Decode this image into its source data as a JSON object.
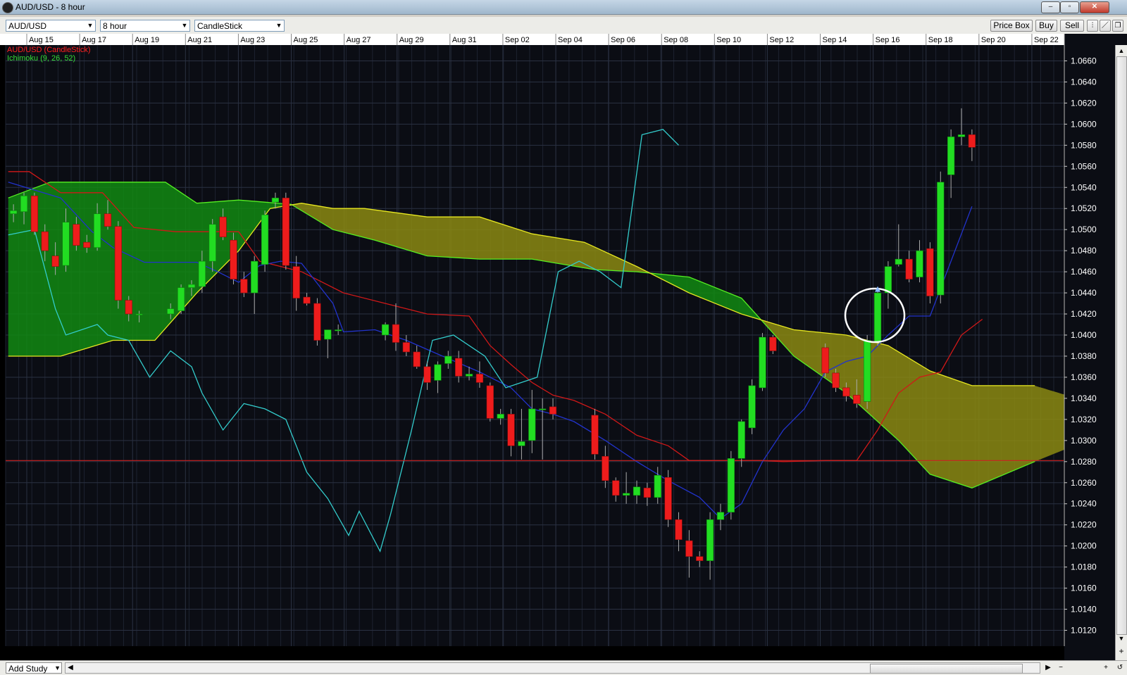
{
  "window": {
    "title": "AUD/USD - 8 hour",
    "controls": {
      "minimize": "–",
      "maximize": "▫",
      "close": "✕"
    }
  },
  "toolbar": {
    "instrument": "AUD/USD",
    "timeframe": "8 hour",
    "chart_type": "CandleStick",
    "price_box": "Price Box",
    "buy": "Buy",
    "sell": "Sell",
    "tool_icons": [
      "bar-icon",
      "draw-icon",
      "popout-icon"
    ]
  },
  "legend": {
    "series1": "AUD/USD (CandleStick)",
    "series1_color": "#ff2020",
    "series2": "Ichimoku (9, 26, 52)",
    "series2_color": "#33dd33"
  },
  "bottom": {
    "add_study": "Add Study"
  },
  "chart_data": {
    "type": "candlestick",
    "instrument": "AUD/USD",
    "timeframe": "8 hour",
    "x_labels": [
      "Aug 15",
      "Aug 17",
      "Aug 19",
      "Aug 21",
      "Aug 23",
      "Aug 25",
      "Aug 27",
      "Aug 29",
      "Aug 31",
      "Sep 02",
      "Sep 04",
      "Sep 06",
      "Sep 08",
      "Sep 10",
      "Sep 12",
      "Sep 14",
      "Sep 16",
      "Sep 18",
      "Sep 20",
      "Sep 22"
    ],
    "y_ticks": [
      "1.0660",
      "1.0640",
      "1.0620",
      "1.0600",
      "1.0580",
      "1.0560",
      "1.0540",
      "1.0520",
      "1.0500",
      "1.0480",
      "1.0460",
      "1.0440",
      "1.0420",
      "1.0400",
      "1.0380",
      "1.0360",
      "1.0340",
      "1.0320",
      "1.0300",
      "1.0280",
      "1.0260",
      "1.0240",
      "1.0220",
      "1.0200",
      "1.0180",
      "1.0160",
      "1.0140",
      "1.0120"
    ],
    "ylim": [
      1.0105,
      1.0675
    ],
    "x_range_bars": [
      0,
      202
    ],
    "horizontal_line": 1.0281,
    "candles": [
      {
        "i": 1,
        "o": 1.0515,
        "h": 1.0524,
        "l": 1.0507,
        "c": 1.0518
      },
      {
        "i": 3,
        "o": 1.0517,
        "h": 1.0535,
        "l": 1.0505,
        "c": 1.0532
      },
      {
        "i": 5,
        "o": 1.0532,
        "h": 1.0535,
        "l": 1.0495,
        "c": 1.0498
      },
      {
        "i": 7,
        "o": 1.0498,
        "h": 1.0505,
        "l": 1.047,
        "c": 1.048
      },
      {
        "i": 9,
        "o": 1.0475,
        "h": 1.0488,
        "l": 1.0457,
        "c": 1.0465
      },
      {
        "i": 11,
        "o": 1.0466,
        "h": 1.052,
        "l": 1.046,
        "c": 1.0507
      },
      {
        "i": 13,
        "o": 1.0505,
        "h": 1.0512,
        "l": 1.048,
        "c": 1.0485
      },
      {
        "i": 15,
        "o": 1.0488,
        "h": 1.0495,
        "l": 1.0478,
        "c": 1.0483
      },
      {
        "i": 17,
        "o": 1.0483,
        "h": 1.0525,
        "l": 1.048,
        "c": 1.0515
      },
      {
        "i": 19,
        "o": 1.0515,
        "h": 1.0528,
        "l": 1.05,
        "c": 1.0503
      },
      {
        "i": 21,
        "o": 1.0503,
        "h": 1.0508,
        "l": 1.0425,
        "c": 1.0433
      },
      {
        "i": 23,
        "o": 1.0433,
        "h": 1.0437,
        "l": 1.0413,
        "c": 1.042
      },
      {
        "i": 25,
        "o": 1.042,
        "h": 1.0423,
        "l": 1.0412,
        "c": 1.042
      },
      {
        "i": 31,
        "o": 1.042,
        "h": 1.043,
        "l": 1.0415,
        "c": 1.0425
      },
      {
        "i": 33,
        "o": 1.0423,
        "h": 1.0448,
        "l": 1.042,
        "c": 1.0445
      },
      {
        "i": 35,
        "o": 1.0445,
        "h": 1.0452,
        "l": 1.0437,
        "c": 1.0448
      },
      {
        "i": 37,
        "o": 1.0446,
        "h": 1.048,
        "l": 1.044,
        "c": 1.047
      },
      {
        "i": 39,
        "o": 1.047,
        "h": 1.051,
        "l": 1.046,
        "c": 1.0505
      },
      {
        "i": 41,
        "o": 1.0512,
        "h": 1.052,
        "l": 1.049,
        "c": 1.0493
      },
      {
        "i": 43,
        "o": 1.049,
        "h": 1.0497,
        "l": 1.0448,
        "c": 1.0453
      },
      {
        "i": 45,
        "o": 1.0453,
        "h": 1.046,
        "l": 1.0436,
        "c": 1.044
      },
      {
        "i": 47,
        "o": 1.044,
        "h": 1.0475,
        "l": 1.042,
        "c": 1.047
      },
      {
        "i": 49,
        "o": 1.0467,
        "h": 1.0518,
        "l": 1.046,
        "c": 1.0514
      },
      {
        "i": 51,
        "o": 1.0526,
        "h": 1.0535,
        "l": 1.052,
        "c": 1.053
      },
      {
        "i": 53,
        "o": 1.053,
        "h": 1.0535,
        "l": 1.0462,
        "c": 1.0466
      },
      {
        "i": 55,
        "o": 1.0465,
        "h": 1.0475,
        "l": 1.0423,
        "c": 1.0435
      },
      {
        "i": 57,
        "o": 1.0436,
        "h": 1.044,
        "l": 1.0428,
        "c": 1.043
      },
      {
        "i": 59,
        "o": 1.043,
        "h": 1.0435,
        "l": 1.039,
        "c": 1.0395
      },
      {
        "i": 61,
        "o": 1.0396,
        "h": 1.0405,
        "l": 1.0378,
        "c": 1.0405
      },
      {
        "i": 63,
        "o": 1.0405,
        "h": 1.041,
        "l": 1.04,
        "c": 1.0405
      },
      {
        "i": 72,
        "o": 1.04,
        "h": 1.0412,
        "l": 1.0395,
        "c": 1.041
      },
      {
        "i": 74,
        "o": 1.041,
        "h": 1.043,
        "l": 1.0385,
        "c": 1.0393
      },
      {
        "i": 76,
        "o": 1.0393,
        "h": 1.04,
        "l": 1.038,
        "c": 1.0384
      },
      {
        "i": 78,
        "o": 1.0384,
        "h": 1.039,
        "l": 1.0368,
        "c": 1.037
      },
      {
        "i": 80,
        "o": 1.037,
        "h": 1.0375,
        "l": 1.0348,
        "c": 1.0355
      },
      {
        "i": 82,
        "o": 1.0357,
        "h": 1.0375,
        "l": 1.0345,
        "c": 1.0372
      },
      {
        "i": 84,
        "o": 1.0373,
        "h": 1.0385,
        "l": 1.0368,
        "c": 1.038
      },
      {
        "i": 86,
        "o": 1.0378,
        "h": 1.0385,
        "l": 1.0355,
        "c": 1.0361
      },
      {
        "i": 88,
        "o": 1.0361,
        "h": 1.037,
        "l": 1.0357,
        "c": 1.0363
      },
      {
        "i": 90,
        "o": 1.0363,
        "h": 1.0375,
        "l": 1.035,
        "c": 1.0355
      },
      {
        "i": 92,
        "o": 1.0352,
        "h": 1.0355,
        "l": 1.0318,
        "c": 1.0321
      },
      {
        "i": 94,
        "o": 1.0321,
        "h": 1.033,
        "l": 1.0315,
        "c": 1.0325
      },
      {
        "i": 96,
        "o": 1.0325,
        "h": 1.033,
        "l": 1.0285,
        "c": 1.0295
      },
      {
        "i": 98,
        "o": 1.0295,
        "h": 1.033,
        "l": 1.0282,
        "c": 1.0299
      },
      {
        "i": 100,
        "o": 1.03,
        "h": 1.0348,
        "l": 1.0288,
        "c": 1.033
      },
      {
        "i": 102,
        "o": 1.033,
        "h": 1.034,
        "l": 1.0282,
        "c": 1.033
      },
      {
        "i": 104,
        "o": 1.0332,
        "h": 1.034,
        "l": 1.032,
        "c": 1.0325
      },
      {
        "i": 112,
        "o": 1.0324,
        "h": 1.033,
        "l": 1.0282,
        "c": 1.0287
      },
      {
        "i": 114,
        "o": 1.0285,
        "h": 1.0295,
        "l": 1.0255,
        "c": 1.0262
      },
      {
        "i": 116,
        "o": 1.0262,
        "h": 1.0265,
        "l": 1.0242,
        "c": 1.0248
      },
      {
        "i": 118,
        "o": 1.0248,
        "h": 1.027,
        "l": 1.024,
        "c": 1.025
      },
      {
        "i": 120,
        "o": 1.0248,
        "h": 1.0262,
        "l": 1.024,
        "c": 1.0256
      },
      {
        "i": 122,
        "o": 1.0255,
        "h": 1.026,
        "l": 1.0238,
        "c": 1.0246
      },
      {
        "i": 124,
        "o": 1.0246,
        "h": 1.0275,
        "l": 1.024,
        "c": 1.0267
      },
      {
        "i": 126,
        "o": 1.0265,
        "h": 1.0272,
        "l": 1.0218,
        "c": 1.0225
      },
      {
        "i": 128,
        "o": 1.0225,
        "h": 1.0232,
        "l": 1.0195,
        "c": 1.0206
      },
      {
        "i": 130,
        "o": 1.0205,
        "h": 1.0215,
        "l": 1.017,
        "c": 1.019
      },
      {
        "i": 132,
        "o": 1.019,
        "h": 1.0195,
        "l": 1.018,
        "c": 1.0186
      },
      {
        "i": 134,
        "o": 1.0186,
        "h": 1.0232,
        "l": 1.0168,
        "c": 1.0225
      },
      {
        "i": 136,
        "o": 1.0225,
        "h": 1.024,
        "l": 1.0215,
        "c": 1.0232
      },
      {
        "i": 138,
        "o": 1.0232,
        "h": 1.029,
        "l": 1.0225,
        "c": 1.0283
      },
      {
        "i": 140,
        "o": 1.0283,
        "h": 1.032,
        "l": 1.0275,
        "c": 1.0318
      },
      {
        "i": 142,
        "o": 1.0312,
        "h": 1.0358,
        "l": 1.0306,
        "c": 1.0352
      },
      {
        "i": 144,
        "o": 1.035,
        "h": 1.0402,
        "l": 1.0347,
        "c": 1.0398
      },
      {
        "i": 146,
        "o": 1.0398,
        "h": 1.04,
        "l": 1.0382,
        "c": 1.0385
      },
      {
        "i": 156,
        "o": 1.0388,
        "h": 1.0392,
        "l": 1.036,
        "c": 1.0364
      },
      {
        "i": 158,
        "o": 1.0364,
        "h": 1.0368,
        "l": 1.0346,
        "c": 1.035
      },
      {
        "i": 160,
        "o": 1.035,
        "h": 1.0355,
        "l": 1.0337,
        "c": 1.0342
      },
      {
        "i": 162,
        "o": 1.0343,
        "h": 1.0358,
        "l": 1.0331,
        "c": 1.0335
      },
      {
        "i": 164,
        "o": 1.0337,
        "h": 1.04,
        "l": 1.033,
        "c": 1.0395
      },
      {
        "i": 166,
        "o": 1.0393,
        "h": 1.0442,
        "l": 1.039,
        "c": 1.044
      },
      {
        "i": 168,
        "o": 1.044,
        "h": 1.047,
        "l": 1.0425,
        "c": 1.0465
      },
      {
        "i": 170,
        "o": 1.0467,
        "h": 1.0505,
        "l": 1.0465,
        "c": 1.0472
      },
      {
        "i": 172,
        "o": 1.0472,
        "h": 1.048,
        "l": 1.045,
        "c": 1.0453
      },
      {
        "i": 174,
        "o": 1.0455,
        "h": 1.049,
        "l": 1.045,
        "c": 1.048
      },
      {
        "i": 176,
        "o": 1.0482,
        "h": 1.0488,
        "l": 1.043,
        "c": 1.0437
      },
      {
        "i": 178,
        "o": 1.0438,
        "h": 1.0555,
        "l": 1.043,
        "c": 1.0545
      },
      {
        "i": 180,
        "o": 1.0552,
        "h": 1.0595,
        "l": 1.053,
        "c": 1.0588
      },
      {
        "i": 182,
        "o": 1.0588,
        "h": 1.0615,
        "l": 1.058,
        "c": 1.059
      },
      {
        "i": 184,
        "o": 1.059,
        "h": 1.0595,
        "l": 1.0565,
        "c": 1.0578
      }
    ],
    "ichimoku": {
      "params": "9, 26, 52",
      "tenkan": [
        [
          0,
          1.0545
        ],
        [
          10,
          1.053
        ],
        [
          16,
          1.0498
        ],
        [
          20,
          1.0483
        ],
        [
          26,
          1.0469
        ],
        [
          36,
          1.0469
        ],
        [
          40,
          1.046
        ],
        [
          44,
          1.045
        ],
        [
          48,
          1.0466
        ],
        [
          52,
          1.047
        ],
        [
          56,
          1.0468
        ],
        [
          62,
          1.043
        ],
        [
          64,
          1.0403
        ],
        [
          70,
          1.0405
        ],
        [
          76,
          1.0395
        ],
        [
          82,
          1.0382
        ],
        [
          90,
          1.0365
        ],
        [
          96,
          1.035
        ],
        [
          100,
          1.033
        ],
        [
          104,
          1.0325
        ],
        [
          108,
          1.0318
        ],
        [
          114,
          1.03
        ],
        [
          120,
          1.028
        ],
        [
          126,
          1.0262
        ],
        [
          132,
          1.0246
        ],
        [
          136,
          1.0226
        ],
        [
          140,
          1.024
        ],
        [
          144,
          1.028
        ],
        [
          148,
          1.031
        ],
        [
          152,
          1.033
        ],
        [
          156,
          1.0365
        ],
        [
          160,
          1.0375
        ],
        [
          164,
          1.038
        ],
        [
          168,
          1.04
        ],
        [
          172,
          1.0418
        ],
        [
          176,
          1.0418
        ],
        [
          180,
          1.047
        ],
        [
          184,
          1.0522
        ]
      ],
      "kijun": [
        [
          0,
          1.0555
        ],
        [
          4,
          1.0555
        ],
        [
          10,
          1.0535
        ],
        [
          18,
          1.0535
        ],
        [
          24,
          1.0502
        ],
        [
          32,
          1.0498
        ],
        [
          40,
          1.0498
        ],
        [
          44,
          1.0498
        ],
        [
          48,
          1.047
        ],
        [
          56,
          1.046
        ],
        [
          64,
          1.044
        ],
        [
          72,
          1.043
        ],
        [
          80,
          1.042
        ],
        [
          88,
          1.0418
        ],
        [
          92,
          1.039
        ],
        [
          96,
          1.0372
        ],
        [
          100,
          1.0355
        ],
        [
          104,
          1.0343
        ],
        [
          108,
          1.0338
        ],
        [
          114,
          1.0325
        ],
        [
          120,
          1.0305
        ],
        [
          126,
          1.0295
        ],
        [
          130,
          1.0281
        ],
        [
          144,
          1.0281
        ],
        [
          148,
          1.028
        ],
        [
          156,
          1.0281
        ],
        [
          162,
          1.0281
        ],
        [
          166,
          1.031
        ],
        [
          170,
          1.0345
        ],
        [
          174,
          1.036
        ],
        [
          178,
          1.0365
        ],
        [
          182,
          1.04
        ],
        [
          186,
          1.0415
        ]
      ],
      "chikou": [
        [
          0,
          1.0495
        ],
        [
          5,
          1.05
        ],
        [
          9,
          1.0425
        ],
        [
          11,
          1.04
        ],
        [
          17,
          1.041
        ],
        [
          19,
          1.04
        ],
        [
          23,
          1.0395
        ],
        [
          27,
          1.036
        ],
        [
          31,
          1.0385
        ],
        [
          35,
          1.037
        ],
        [
          37,
          1.0345
        ],
        [
          41,
          1.031
        ],
        [
          45,
          1.0335
        ],
        [
          49,
          1.033
        ],
        [
          53,
          1.032
        ],
        [
          57,
          1.027
        ],
        [
          61,
          1.0245
        ],
        [
          65,
          1.021
        ],
        [
          67,
          1.0233
        ],
        [
          71,
          1.0195
        ],
        [
          73,
          1.023
        ],
        [
          77,
          1.031
        ],
        [
          81,
          1.0395
        ],
        [
          85,
          1.04
        ],
        [
          91,
          1.038
        ],
        [
          95,
          1.035
        ],
        [
          101,
          1.036
        ],
        [
          105,
          1.046
        ],
        [
          109,
          1.047
        ],
        [
          113,
          1.046
        ],
        [
          117,
          1.0445
        ],
        [
          121,
          1.059
        ],
        [
          125,
          1.0595
        ],
        [
          128,
          1.058
        ]
      ],
      "span_a": [
        [
          0,
          1.053
        ],
        [
          8,
          1.0545
        ],
        [
          12,
          1.0545
        ],
        [
          18,
          1.0545
        ],
        [
          24,
          1.0545
        ],
        [
          30,
          1.0545
        ],
        [
          36,
          1.0525
        ],
        [
          44,
          1.0528
        ],
        [
          54,
          1.0524
        ],
        [
          62,
          1.05
        ],
        [
          70,
          1.049
        ],
        [
          80,
          1.0475
        ],
        [
          90,
          1.0472
        ],
        [
          100,
          1.0472
        ],
        [
          112,
          1.0462
        ],
        [
          120,
          1.046
        ],
        [
          130,
          1.0455
        ],
        [
          140,
          1.0435
        ],
        [
          150,
          1.038
        ],
        [
          160,
          1.0345
        ],
        [
          170,
          1.03
        ],
        [
          176,
          1.0268
        ],
        [
          184,
          1.0255
        ],
        [
          196,
          1.028
        ],
        [
          206,
          1.03
        ],
        [
          212,
          1.033
        ],
        [
          220,
          1.036
        ],
        [
          230,
          1.04
        ]
      ],
      "span_b": [
        [
          0,
          1.038
        ],
        [
          10,
          1.038
        ],
        [
          20,
          1.0395
        ],
        [
          28,
          1.0395
        ],
        [
          36,
          1.044
        ],
        [
          44,
          1.048
        ],
        [
          50,
          1.052
        ],
        [
          56,
          1.0525
        ],
        [
          62,
          1.052
        ],
        [
          68,
          1.052
        ],
        [
          80,
          1.0512
        ],
        [
          90,
          1.0512
        ],
        [
          100,
          1.0496
        ],
        [
          110,
          1.0488
        ],
        [
          120,
          1.0465
        ],
        [
          130,
          1.044
        ],
        [
          140,
          1.042
        ],
        [
          150,
          1.0405
        ],
        [
          160,
          1.04
        ],
        [
          168,
          1.039
        ],
        [
          176,
          1.0366
        ],
        [
          184,
          1.0352
        ],
        [
          196,
          1.0352
        ],
        [
          204,
          1.034
        ],
        [
          210,
          1.0322
        ],
        [
          220,
          1.033
        ],
        [
          230,
          1.0372
        ]
      ]
    },
    "annotation": {
      "type": "circle",
      "x_bar": 166,
      "y": 1.042
    }
  }
}
